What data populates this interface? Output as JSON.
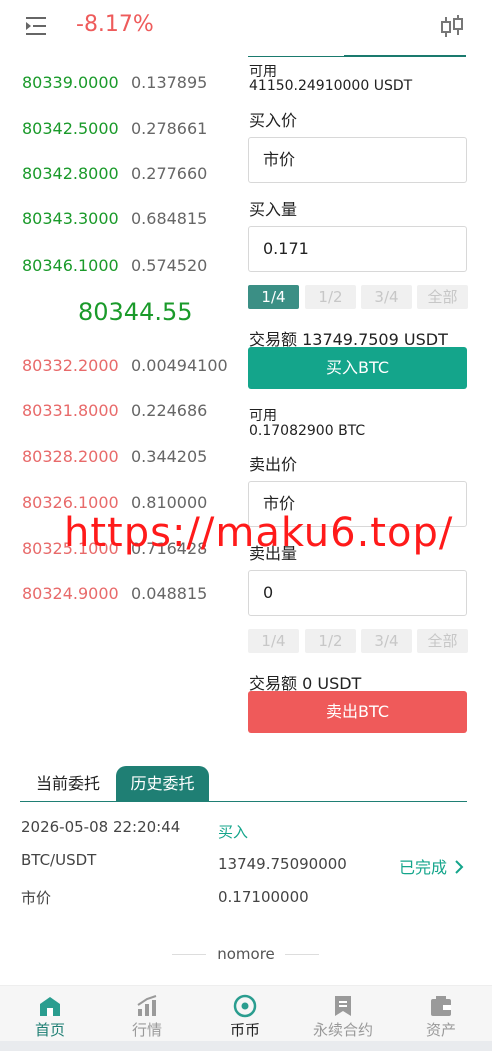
{
  "header": {
    "change": "-8.17%"
  },
  "orderbook": {
    "asks": [
      {
        "price": "80339.0000",
        "amount": "0.137895"
      },
      {
        "price": "80342.5000",
        "amount": "0.278661"
      },
      {
        "price": "80342.8000",
        "amount": "0.277660"
      },
      {
        "price": "80343.3000",
        "amount": "0.684815"
      },
      {
        "price": "80346.1000",
        "amount": "0.574520"
      }
    ],
    "last_price": "80344.55",
    "bids": [
      {
        "price": "80332.2000",
        "amount": "0.00494100"
      },
      {
        "price": "80331.8000",
        "amount": "0.224686"
      },
      {
        "price": "80328.2000",
        "amount": "0.344205"
      },
      {
        "price": "80326.1000",
        "amount": "0.810000"
      },
      {
        "price": "80325.1000",
        "amount": "0.716428"
      },
      {
        "price": "80324.9000",
        "amount": "0.048815"
      }
    ]
  },
  "buy": {
    "available_label": "可用",
    "available_value": "41150.24910000 USDT",
    "price_label": "买入价",
    "price_value": "市价",
    "amount_label": "买入量",
    "amount_value": "0.171",
    "percents": [
      "1/4",
      "1/2",
      "3/4",
      "全部"
    ],
    "active_percent": "1/4",
    "total_label": "交易额 13749.7509 USDT",
    "button": "买入BTC"
  },
  "sell": {
    "available_label": "可用",
    "available_value": "0.17082900 BTC",
    "price_label": "卖出价",
    "price_value": "市价",
    "amount_label": "卖出量",
    "amount_value": "0",
    "percents": [
      "1/4",
      "1/2",
      "3/4",
      "全部"
    ],
    "total_label": "交易额 0 USDT",
    "button": "卖出BTC"
  },
  "orders": {
    "tabs": [
      "当前委托",
      "历史委托"
    ],
    "active_tab": "历史委托",
    "items": [
      {
        "time": "2026-05-08 22:20:44",
        "side": "买入",
        "pair": "BTC/USDT",
        "total": "13749.75090000",
        "status": "已完成",
        "type": "市价",
        "amount": "0.17100000"
      }
    ],
    "nomore": "nomore"
  },
  "nav": {
    "items": [
      "首页",
      "行情",
      "币币",
      "永续合约",
      "资产"
    ],
    "active": "币币"
  },
  "watermark": "https://maku6.top/",
  "colors": {
    "up_green": "#1a9a2a",
    "down_red": "#e86a6a",
    "accent_teal": "#14a58b",
    "sell_red": "#ef5a5a"
  }
}
